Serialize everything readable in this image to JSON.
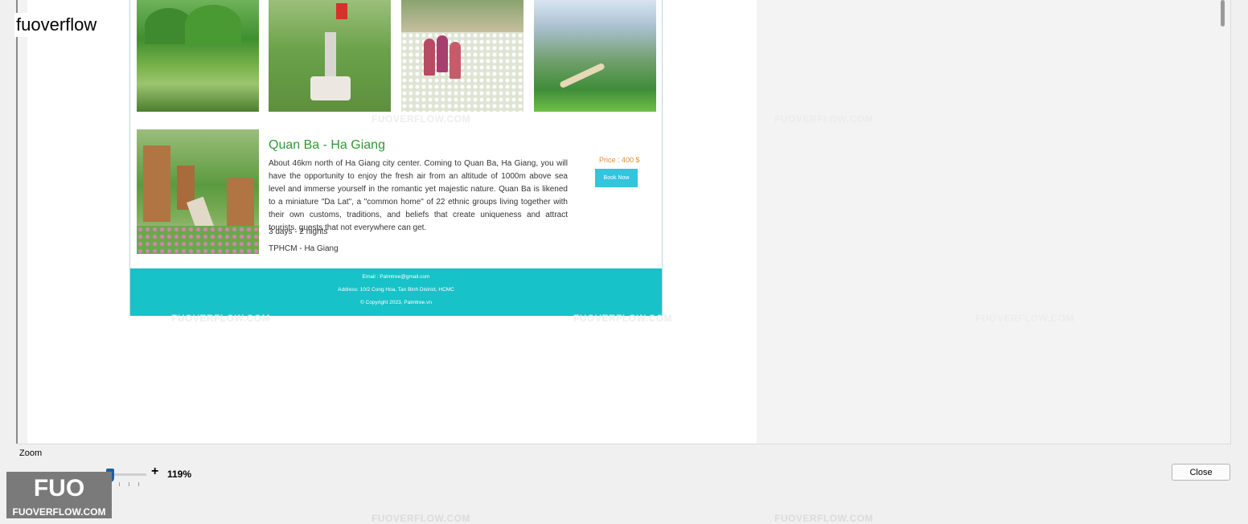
{
  "app": {
    "title": "fuoverflow"
  },
  "tour": {
    "title": "Quan Ba - Ha Giang",
    "description": "About 46km north of Ha Giang city center. Coming to Quan Ba, Ha Giang, you will have the opportunity to enjoy the fresh air from an altitude of 1000m above sea level and immerse yourself in the romantic yet majestic nature. Quan Ba is likened to a miniature \"Da Lat\", a \"common home\" of 22 ethnic groups living together with their own customs, traditions, and beliefs that create uniqueness and attract tourists. guests that not everywhere can get.",
    "duration": "3 days - 2 nights",
    "route": "TPHCM - Ha Giang",
    "price": "Price : 400 $",
    "book_label": "Book Now"
  },
  "footer": {
    "email": "Email : Palmtree@gmail.com",
    "address": "Address: 10/2 Cong Hoa, Tan Binh District, HCMC",
    "copyright": "© Copyright 2023, Palmtree.vn"
  },
  "toolbar": {
    "zoom_label": "Zoom",
    "zoom_minus": "-",
    "zoom_plus": "+",
    "zoom_value": "119%",
    "zoom_level_percent": 119,
    "close_label": "Close"
  },
  "branding": {
    "logo_mark": "FUO",
    "logo_text": "FUOVERFLOW.COM",
    "watermark": "FUOVERFLOW.COM"
  },
  "colors": {
    "title_green": "#2e9a35",
    "price_orange": "#e0902e",
    "button_cyan": "#35c3dd",
    "footer_teal": "#17c2c8",
    "slider_blue": "#1f5fa6"
  }
}
